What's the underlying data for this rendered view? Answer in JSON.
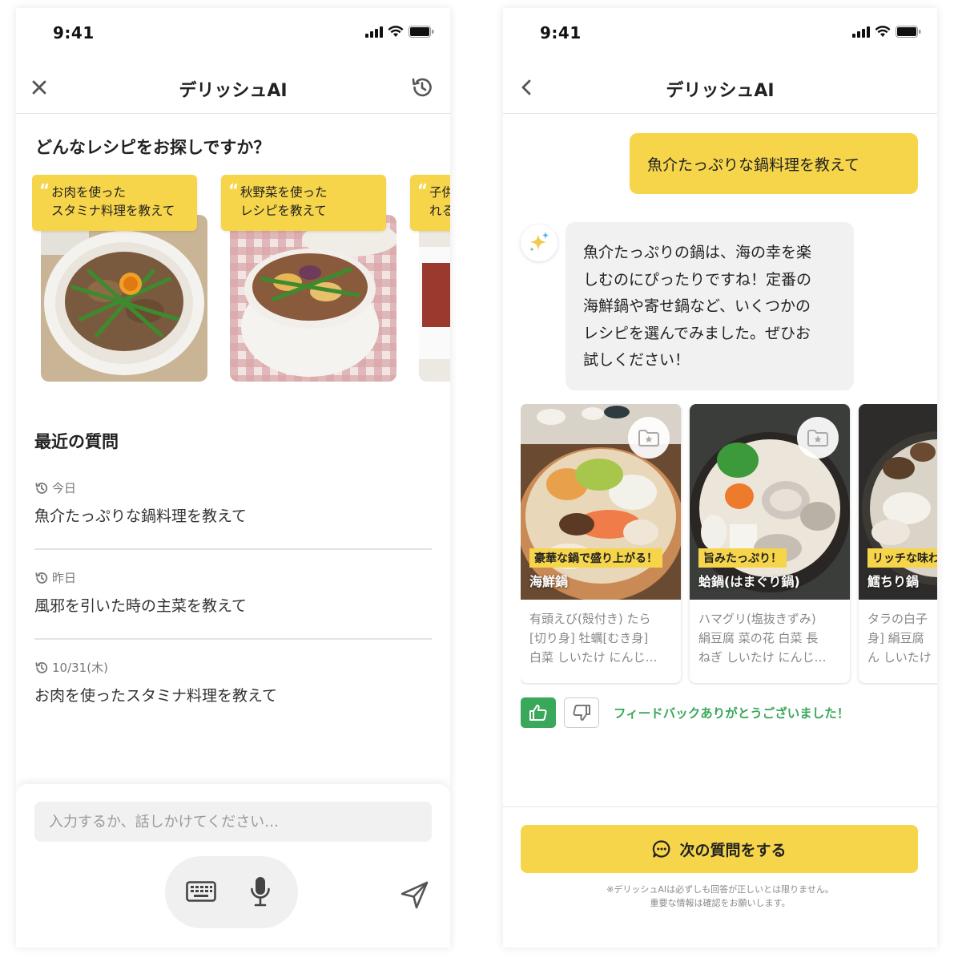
{
  "left": {
    "status_time": "9:41",
    "nav_title": "デリッシュAI",
    "section_title": "どんなレシピをお探しですか？",
    "suggestions": [
      {
        "line1": "お肉を使った",
        "line2": "スタミナ料理を教えて"
      },
      {
        "line1": "秋野菜を使った",
        "line2": "レシピを教えて"
      },
      {
        "line1": "子供",
        "line2": "れる"
      }
    ],
    "recent_title": "最近の質問",
    "recent": [
      {
        "date": "今日",
        "text": "魚介たっぷりな鍋料理を教えて"
      },
      {
        "date": "昨日",
        "text": "風邪を引いた時の主菜を教えて"
      },
      {
        "date": "10/31(木)",
        "text": "お肉を使ったスタミナ料理を教えて"
      }
    ],
    "input_placeholder": "入力するか、話しかけてください…"
  },
  "right": {
    "status_time": "9:41",
    "nav_title": "デリッシュAI",
    "user_message": "魚介たっぷりな鍋料理を教えて",
    "ai_lines": [
      "魚介たっぷりの鍋は、海の幸を楽",
      "しむのにぴったりですね！定番の",
      "海鮮鍋や寄せ鍋など、いくつかの",
      "レシピを選んでみました。ぜひお",
      "試しください！"
    ],
    "recipes": [
      {
        "tag": "豪華な鍋で盛り上がる！",
        "name": "海鮮鍋",
        "ingr": [
          "有頭えび(殻付き) たら",
          "[切り身] 牡蠣[むき身]",
          "白菜 しいたけ にんじ…"
        ]
      },
      {
        "tag": "旨みたっぷり！",
        "name": "蛤鍋(はまぐり鍋)",
        "ingr": [
          "ハマグリ(塩抜きずみ)",
          "絹豆腐 菜の花 白菜 長",
          "ねぎ しいたけ にんじ…"
        ]
      },
      {
        "tag": "リッチな味わ",
        "name": "鱈ちり鍋",
        "ingr": [
          "タラの白子",
          "身] 絹豆腐",
          "ん しいたけ"
        ]
      }
    ],
    "feedback_text": "フィードバックありがとうございました！",
    "next_button": "次の質問をする",
    "disclaimer_1": "※デリッシュAIは必ずしも回答が正しいとは限りません。",
    "disclaimer_2": "重要な情報は確認をお願いします。"
  },
  "colors": {
    "accent_yellow": "#f6d54b",
    "feedback_green": "#3aa85a"
  }
}
